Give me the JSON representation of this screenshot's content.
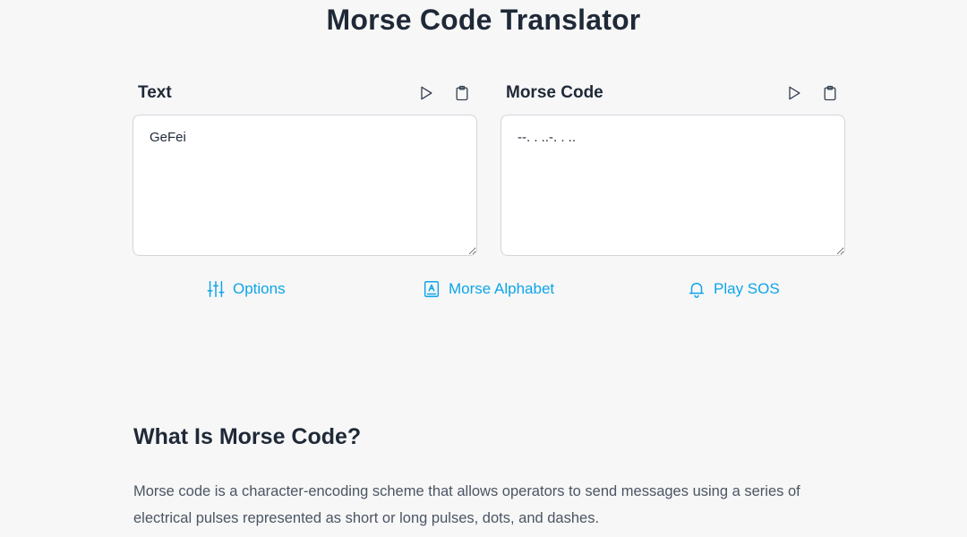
{
  "page": {
    "title": "Morse Code Translator"
  },
  "text_panel": {
    "label": "Text",
    "value": "GeFei"
  },
  "morse_panel": {
    "label": "Morse Code",
    "value": "--. . ..-. . .."
  },
  "links": {
    "options": "Options",
    "alphabet": "Morse Alphabet",
    "sos": "Play SOS"
  },
  "info": {
    "heading": "What Is Morse Code?",
    "body": "Morse code is a character-encoding scheme that allows operators to send messages using a series of electrical pulses represented as short or long pulses, dots, and dashes."
  },
  "colors": {
    "accent": "#0ea5e9",
    "text": "#1f2937",
    "background": "#f7f7f7"
  },
  "icons": [
    "play-icon",
    "clipboard-icon",
    "sliders-icon",
    "book-icon",
    "bell-icon"
  ]
}
